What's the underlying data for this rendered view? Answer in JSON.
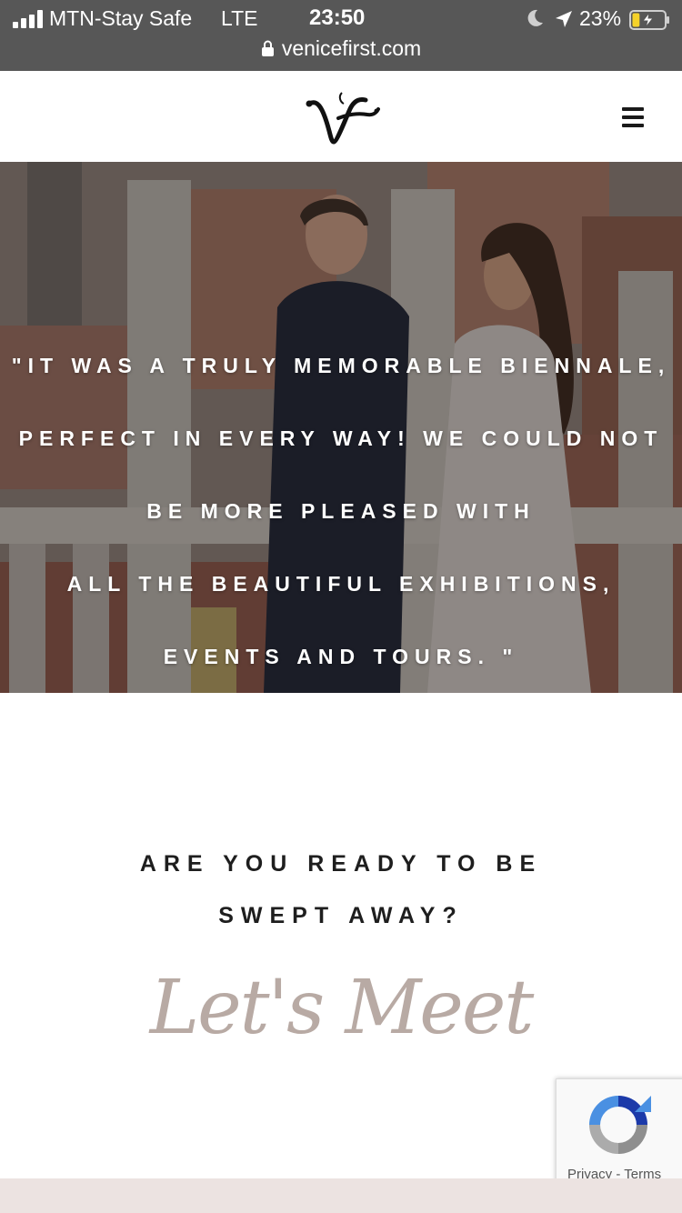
{
  "status_bar": {
    "carrier": "MTN-Stay Safe",
    "network": "LTE",
    "time": "23:50",
    "battery_percent": "23%",
    "battery_level": 0.23,
    "charging": true,
    "icons": [
      "signal-bars-icon",
      "moon-icon",
      "location-arrow-icon",
      "battery-charging-icon"
    ]
  },
  "browser": {
    "url": "venicefirst.com",
    "icon": "lock-icon"
  },
  "header": {
    "logo": "VF",
    "menu_icon": "hamburger-menu-icon"
  },
  "hero": {
    "quote_lines": [
      "\"IT WAS A TRULY MEMORABLE BIENNALE,",
      "PERFECT IN EVERY WAY! WE COULD NOT",
      "BE MORE PLEASED WITH",
      "ALL THE BEAUTIFUL EXHIBITIONS,",
      "EVENTS AND TOURS. \""
    ]
  },
  "cta": {
    "heading_lines": [
      "ARE YOU READY TO BE",
      "SWEPT AWAY?"
    ],
    "script_text": "Let's Meet"
  },
  "recaptcha": {
    "privacy": "Privacy",
    "separator": "-",
    "terms": "Terms"
  },
  "colors": {
    "status_bar_bg": "#575757",
    "script_text": "#b8aaa4",
    "footer_band": "#ece3e1",
    "battery_fill": "#f5d22a"
  }
}
